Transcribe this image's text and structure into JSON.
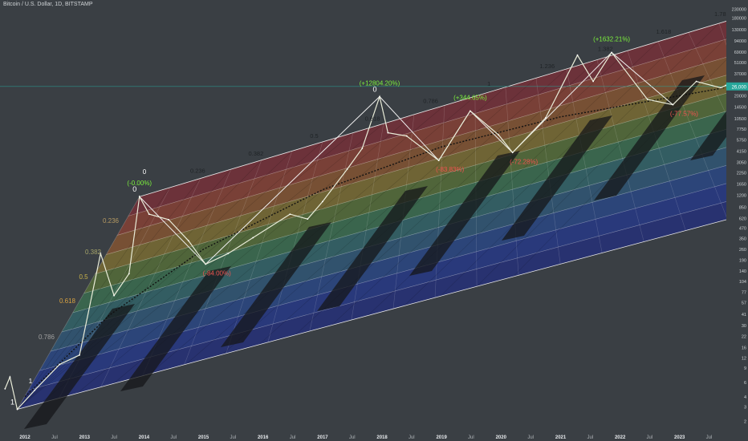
{
  "header": {
    "symbol_title": "Bitcoin / U.S. Dollar, 1D, BITSTAMP"
  },
  "chart_data": {
    "type": "line",
    "title": "Bitcoin / U.S. Dollar, 1D, BITSTAMP",
    "xlabel": "",
    "ylabel": "",
    "y_scale": "log",
    "xlim": [
      "2011-08-01",
      "2023-10-15"
    ],
    "ylim": [
      1.5,
      300000
    ],
    "grid": false,
    "price_axis_ticks": [
      230000,
      180000,
      130000,
      94000,
      69000,
      51000,
      37000,
      27000,
      20000,
      14500,
      10500,
      7750,
      5750,
      4150,
      3050,
      2250,
      1650,
      1200,
      850,
      620,
      470,
      350,
      260,
      190,
      140,
      104,
      77,
      57,
      41,
      30,
      22,
      16,
      12,
      9,
      6,
      4,
      3,
      2
    ],
    "current_price_label": "26,000",
    "time_axis_ticks": [
      {
        "label": "2012",
        "date": "2012-01-01"
      },
      {
        "label": "Jul",
        "date": "2012-07-01"
      },
      {
        "label": "2013",
        "date": "2013-01-01"
      },
      {
        "label": "Jul",
        "date": "2013-07-01"
      },
      {
        "label": "2014",
        "date": "2014-01-01"
      },
      {
        "label": "Jul",
        "date": "2014-07-01"
      },
      {
        "label": "2015",
        "date": "2015-01-01"
      },
      {
        "label": "Jul",
        "date": "2015-07-01"
      },
      {
        "label": "2016",
        "date": "2016-01-01"
      },
      {
        "label": "Jul",
        "date": "2016-07-01"
      },
      {
        "label": "2017",
        "date": "2017-01-01"
      },
      {
        "label": "Jul",
        "date": "2017-07-01"
      },
      {
        "label": "2018",
        "date": "2018-01-01"
      },
      {
        "label": "Jul",
        "date": "2018-07-01"
      },
      {
        "label": "2019",
        "date": "2019-01-01"
      },
      {
        "label": "Jul",
        "date": "2019-07-01"
      },
      {
        "label": "2020",
        "date": "2020-01-01"
      },
      {
        "label": "Jul",
        "date": "2020-07-01"
      },
      {
        "label": "2021",
        "date": "2021-01-01"
      },
      {
        "label": "Jul",
        "date": "2021-07-01"
      },
      {
        "label": "2022",
        "date": "2022-01-01"
      },
      {
        "label": "Jul",
        "date": "2022-07-01"
      },
      {
        "label": "2023",
        "date": "2023-01-01"
      },
      {
        "label": "Jul",
        "date": "2023-07-01"
      }
    ],
    "price_series": [
      {
        "date": "2011-09-01",
        "value": 5
      },
      {
        "date": "2011-10-01",
        "value": 7
      },
      {
        "date": "2011-11-15",
        "value": 2.8
      },
      {
        "date": "2012-03-01",
        "value": 4.8
      },
      {
        "date": "2012-08-01",
        "value": 10
      },
      {
        "date": "2012-12-01",
        "value": 13
      },
      {
        "date": "2013-04-09",
        "value": 230
      },
      {
        "date": "2013-07-01",
        "value": 70
      },
      {
        "date": "2013-10-01",
        "value": 130
      },
      {
        "date": "2013-12-04",
        "value": 1150
      },
      {
        "date": "2014-02-01",
        "value": 700
      },
      {
        "date": "2014-06-01",
        "value": 600
      },
      {
        "date": "2014-10-01",
        "value": 330
      },
      {
        "date": "2015-01-14",
        "value": 170
      },
      {
        "date": "2015-06-01",
        "value": 230
      },
      {
        "date": "2015-11-01",
        "value": 360
      },
      {
        "date": "2016-06-15",
        "value": 700
      },
      {
        "date": "2016-10-01",
        "value": 610
      },
      {
        "date": "2017-01-01",
        "value": 1000
      },
      {
        "date": "2017-06-01",
        "value": 2500
      },
      {
        "date": "2017-09-01",
        "value": 4500
      },
      {
        "date": "2017-12-17",
        "value": 19500
      },
      {
        "date": "2018-02-06",
        "value": 7000
      },
      {
        "date": "2018-06-01",
        "value": 6400
      },
      {
        "date": "2018-12-15",
        "value": 3200
      },
      {
        "date": "2019-06-26",
        "value": 13000
      },
      {
        "date": "2019-12-17",
        "value": 6600
      },
      {
        "date": "2020-03-12",
        "value": 4000
      },
      {
        "date": "2020-10-01",
        "value": 10700
      },
      {
        "date": "2021-04-14",
        "value": 63000
      },
      {
        "date": "2021-07-20",
        "value": 30000
      },
      {
        "date": "2021-11-10",
        "value": 68000
      },
      {
        "date": "2022-06-18",
        "value": 18000
      },
      {
        "date": "2022-11-21",
        "value": 15500
      },
      {
        "date": "2023-04-14",
        "value": 30000
      },
      {
        "date": "2023-09-11",
        "value": 25000
      },
      {
        "date": "2023-10-12",
        "value": 26800
      }
    ],
    "peak_labels": [
      {
        "text": "(-0.00%)",
        "date": "2013-12-04",
        "value": 1150
      },
      {
        "text": "(+12804.20%)",
        "date": "2017-12-17",
        "value": 19500
      },
      {
        "text": "(+344.65%)",
        "date": "2019-06-26",
        "value": 13000
      },
      {
        "text": "(+1632.21%)",
        "date": "2021-11-10",
        "value": 68000
      }
    ],
    "trough_labels": [
      {
        "text": "(-84.00%)",
        "date": "2015-01-14",
        "value": 170
      },
      {
        "text": "(-83.83%)",
        "date": "2018-12-15",
        "value": 3200
      },
      {
        "text": "(-72.28%)",
        "date": "2020-03-12",
        "value": 4000
      },
      {
        "text": "(-77.57%)",
        "date": "2022-11-21",
        "value": 15500
      }
    ],
    "fib_labels_left": [
      "1",
      "0.786",
      "0.618",
      "0.5",
      "0.382",
      "0.236",
      "0"
    ],
    "fib_labels_top": [
      "0.236",
      "0.382",
      "0.5",
      "0.618",
      "0.786",
      "1",
      "1.236",
      "1.382",
      "1.618",
      "1.786"
    ],
    "anchor_labels": [
      {
        "text": "1",
        "date": "2011-11-15",
        "value": 2.8
      },
      {
        "text": "0",
        "date": "2013-12-04",
        "value": 1150
      },
      {
        "text": "0",
        "date": "2017-12-17",
        "value": 19500
      }
    ],
    "band_colors": [
      "#8b2a34",
      "#a0412e",
      "#9c5a2a",
      "#8f7a2c",
      "#5d7d34",
      "#3a7d52",
      "#2f6f74",
      "#2b5e86",
      "#24489a",
      "#1f369c",
      "#1d2a8a"
    ]
  }
}
